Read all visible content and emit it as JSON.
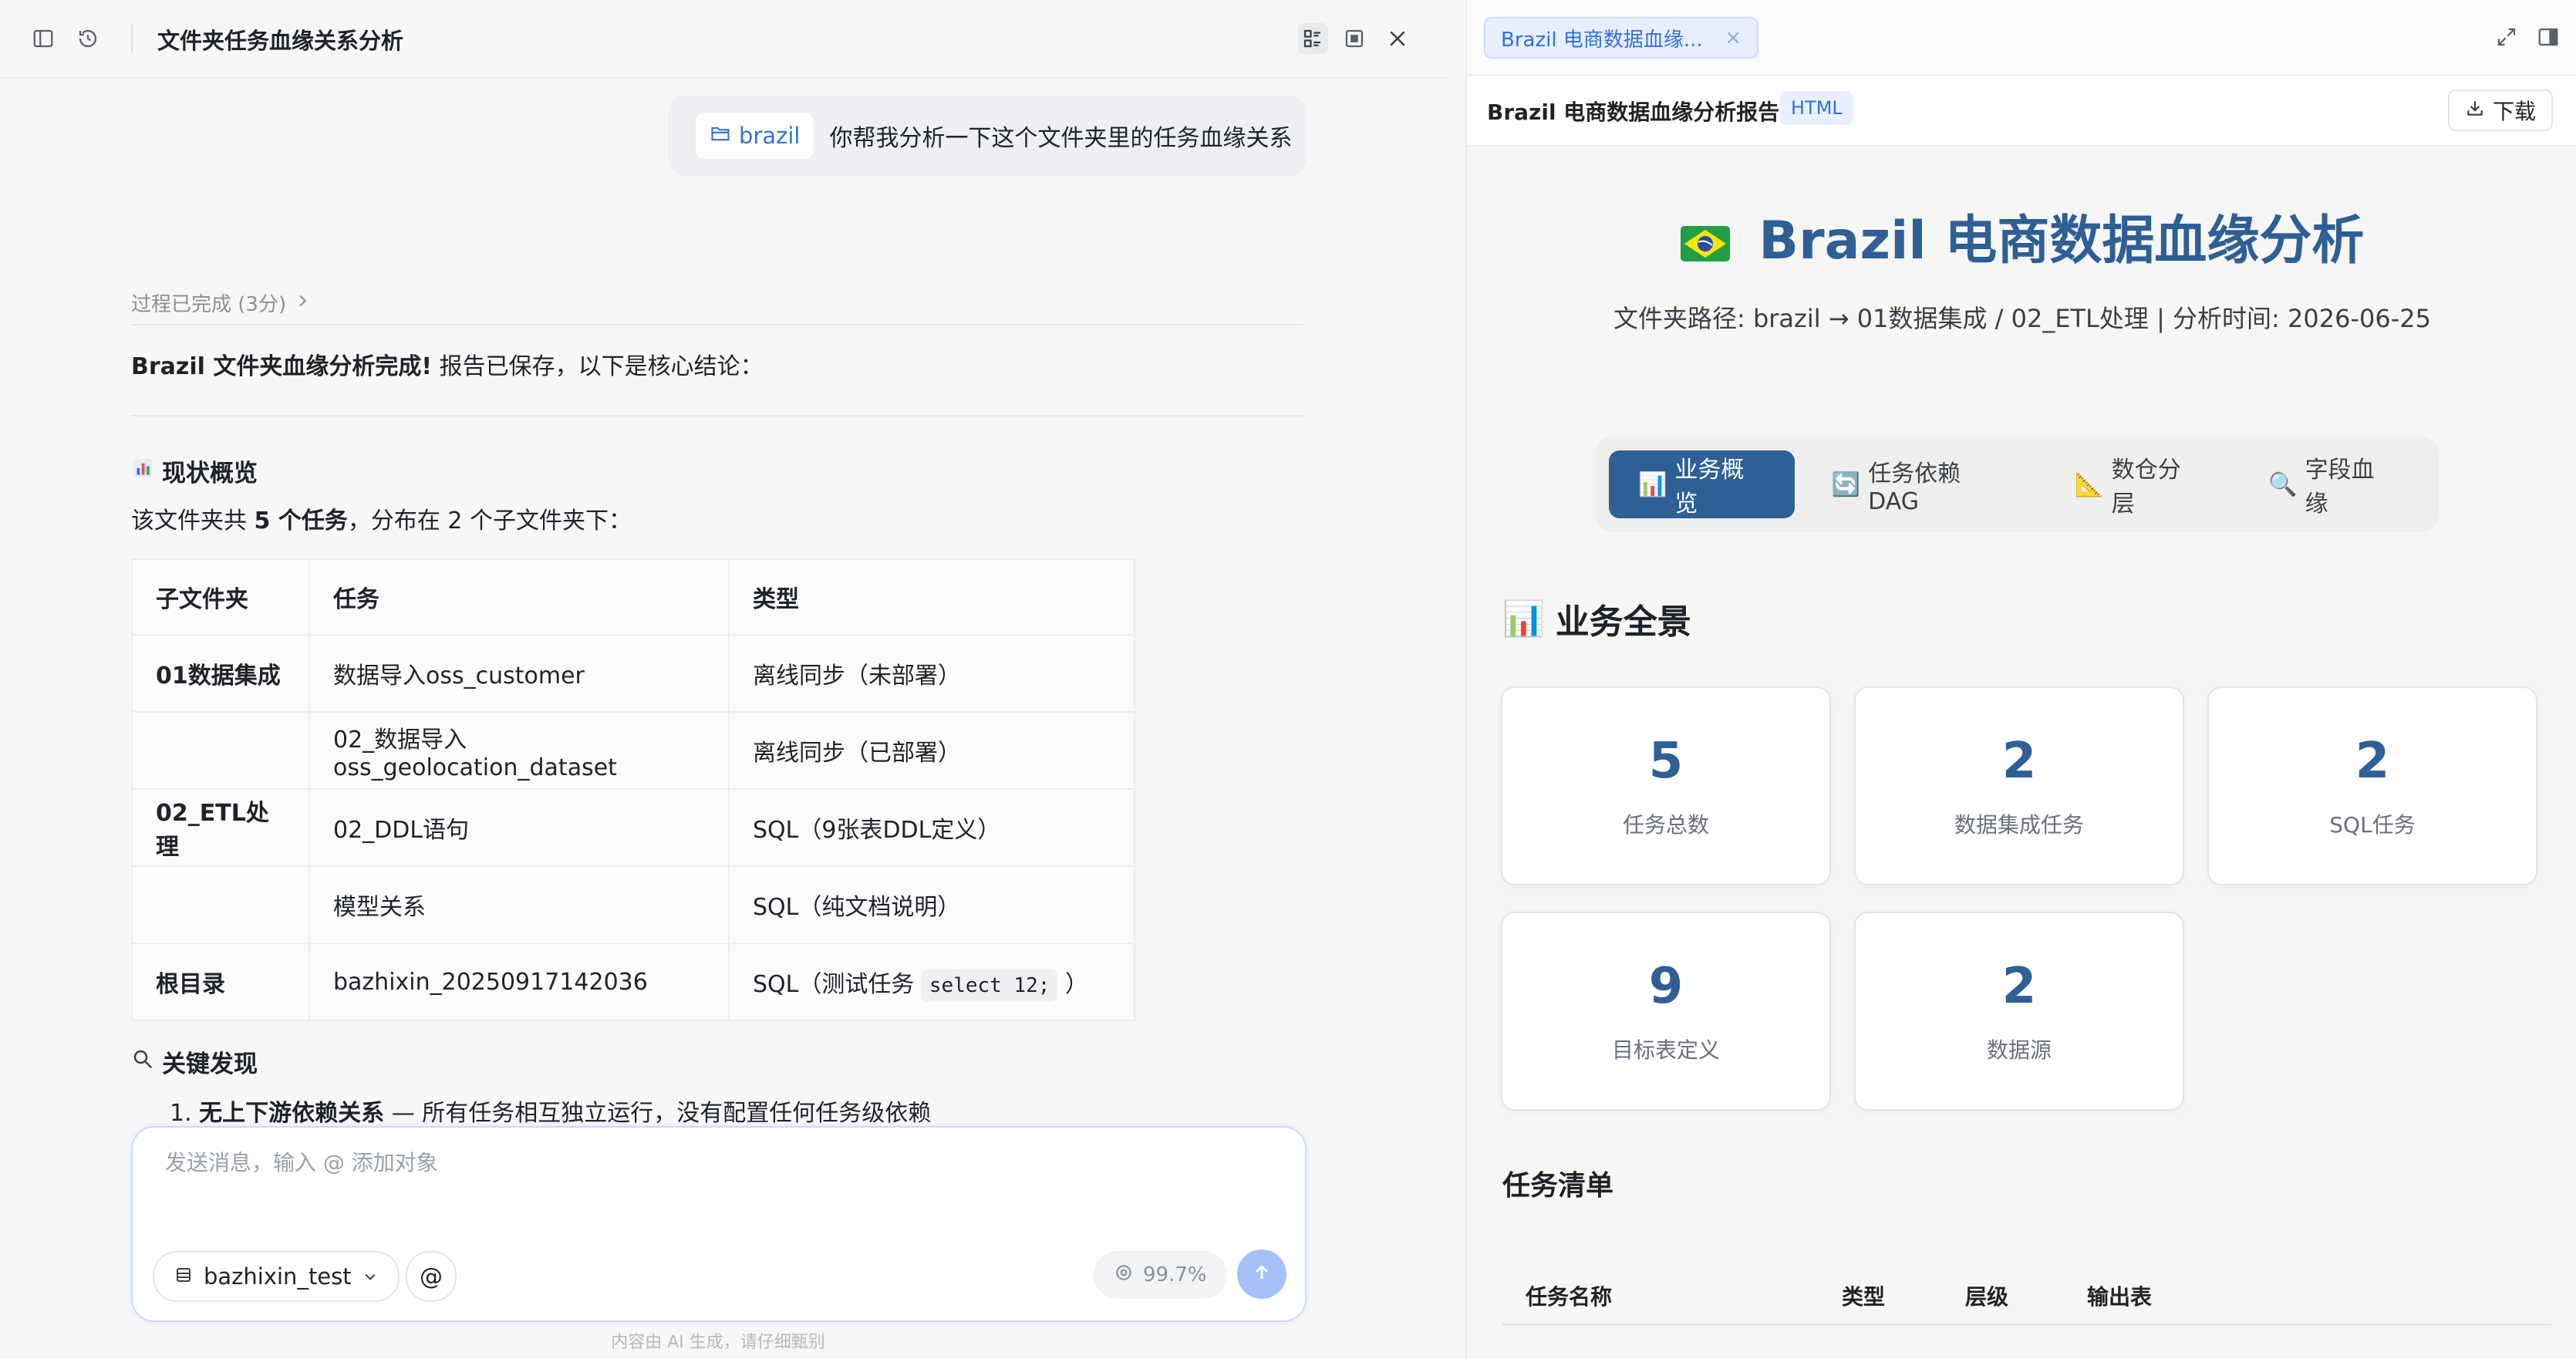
{
  "left": {
    "chat_title": "文件夹任务血缘关系分析",
    "user_message": {
      "folder_chip": "brazil",
      "text": "你帮我分析一下这个文件夹里的任务血缘关系"
    },
    "process_status": "过程已完成 (3分)",
    "summary_bold": "Brazil 文件夹血缘分析完成!",
    "summary_rest": " 报告已保存，以下是核心结论：",
    "overview_heading": "现状概览",
    "overview_para_pre": "该文件夹共 ",
    "overview_para_bold": "5 个任务",
    "overview_para_post": "，分布在 2 个子文件夹下：",
    "table": {
      "headers": [
        "子文件夹",
        "任务",
        "类型"
      ],
      "rows": [
        {
          "folder": "01数据集成",
          "task": "数据导入oss_customer",
          "type": "离线同步（未部署）"
        },
        {
          "folder": "",
          "task": "02_数据导入oss_geolocation_dataset",
          "type": "离线同步（已部署）"
        },
        {
          "folder": "02_ETL处理",
          "task": "02_DDL语句",
          "type": "SQL（9张表DDL定义）"
        },
        {
          "folder": "",
          "task": "模型关系",
          "type": "SQL（纯文档说明）"
        },
        {
          "folder": "根目录",
          "task": "bazhixin_20250917142036",
          "type_pre": "SQL（测试任务 ",
          "type_code": "select 12;",
          "type_post": " ）"
        }
      ]
    },
    "findings_heading": "关键发现",
    "finding_1_num": "1.",
    "finding_1_bold": "无上下游依赖关系",
    "finding_1_rest": " — 所有任务相互独立运行，没有配置任何任务级依赖",
    "composer": {
      "placeholder": "发送消息，输入 @ 添加对象",
      "db_select": "bazhixin_test",
      "at_label": "@",
      "context_usage": "99.7%"
    },
    "disclaimer": "内容由 AI 生成，请仔细甄别"
  },
  "right": {
    "file_tab": "Brazil 电商数据血缘...",
    "file_tab_close": "×",
    "report_title": "Brazil 电商数据血缘分析报告",
    "format_badge": "HTML",
    "download_label": "下载",
    "h1": "Brazil 电商数据血缘分析",
    "subtitle": "文件夹路径: brazil → 01数据集成 / 02_ETL处理 | 分析时间: 2026-06-25",
    "nav_tabs": [
      {
        "icon": "📊",
        "label": "业务概览"
      },
      {
        "icon": "🔄",
        "label": "任务依赖DAG"
      },
      {
        "icon": "📐",
        "label": "数仓分层"
      },
      {
        "icon": "🔍",
        "label": "字段血缘"
      }
    ],
    "section_icon": "📊",
    "section_heading": "业务全景",
    "stats": [
      {
        "value": "5",
        "label": "任务总数"
      },
      {
        "value": "2",
        "label": "数据集成任务"
      },
      {
        "value": "2",
        "label": "SQL任务"
      },
      {
        "value": "9",
        "label": "目标表定义"
      },
      {
        "value": "2",
        "label": "数据源"
      }
    ],
    "tasklist_heading": "任务清单",
    "tasklist_headers": [
      "任务名称",
      "类型",
      "层级",
      "输出表"
    ]
  },
  "colors": {
    "accent_blue": "#3370d6",
    "report_blue": "#2e5f95",
    "send_button": "#a6c0f7"
  },
  "icons": [
    "sidebar-toggle-icon",
    "history-icon",
    "grid-view-icon",
    "stop-icon",
    "close-icon",
    "folder-icon",
    "chevron-right-icon",
    "database-icon",
    "chevron-down-icon",
    "context-icon",
    "arrow-up-icon",
    "expand-icon",
    "panel-icon",
    "download-icon",
    "brazil-flag-icon"
  ]
}
